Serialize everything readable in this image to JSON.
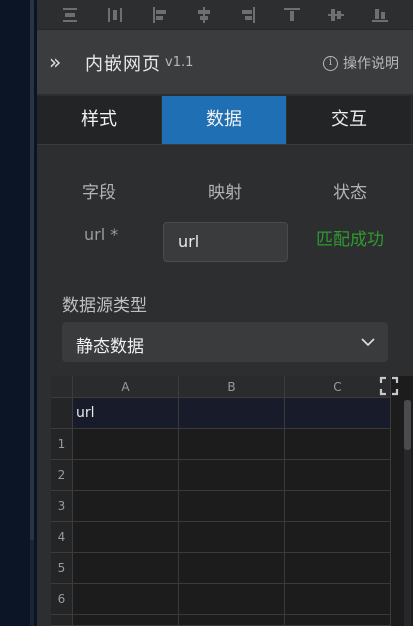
{
  "header": {
    "collapse_icon": "double-chevron-right-icon",
    "title": "内嵌网页",
    "version": "v1.1",
    "help_icon": "info-circle-icon",
    "help_label": "操作说明"
  },
  "toolbar": {
    "icons": [
      "align-top-edge-icon",
      "align-horizontal-distribute-icon",
      "align-left-icon",
      "align-center-vertical-icon",
      "align-right-icon",
      "align-top-icon",
      "align-middle-icon",
      "align-bottom-icon"
    ]
  },
  "tabs": [
    {
      "label": "样式",
      "active": false
    },
    {
      "label": "数据",
      "active": true
    },
    {
      "label": "交互",
      "active": false
    }
  ],
  "fields": {
    "col_field": "字段",
    "col_mapping": "映射",
    "col_status": "状态",
    "url_label": "url *",
    "url_value": "url",
    "url_status": "匹配成功",
    "status_color": "#2f9a2f"
  },
  "datasource": {
    "label": "数据源类型",
    "selected": "静态数据",
    "chevron_icon": "chevron-down-icon"
  },
  "sheet": {
    "columns": [
      "A",
      "B",
      "C"
    ],
    "header_cells": [
      "url",
      "",
      ""
    ],
    "row_numbers": [
      "1",
      "2",
      "3",
      "4",
      "5",
      "6"
    ],
    "expand_icon": "fullscreen-icon"
  },
  "colors": {
    "accent": "#1f6fb4",
    "panel": "#2d2e30",
    "success": "#2f9a2f"
  }
}
